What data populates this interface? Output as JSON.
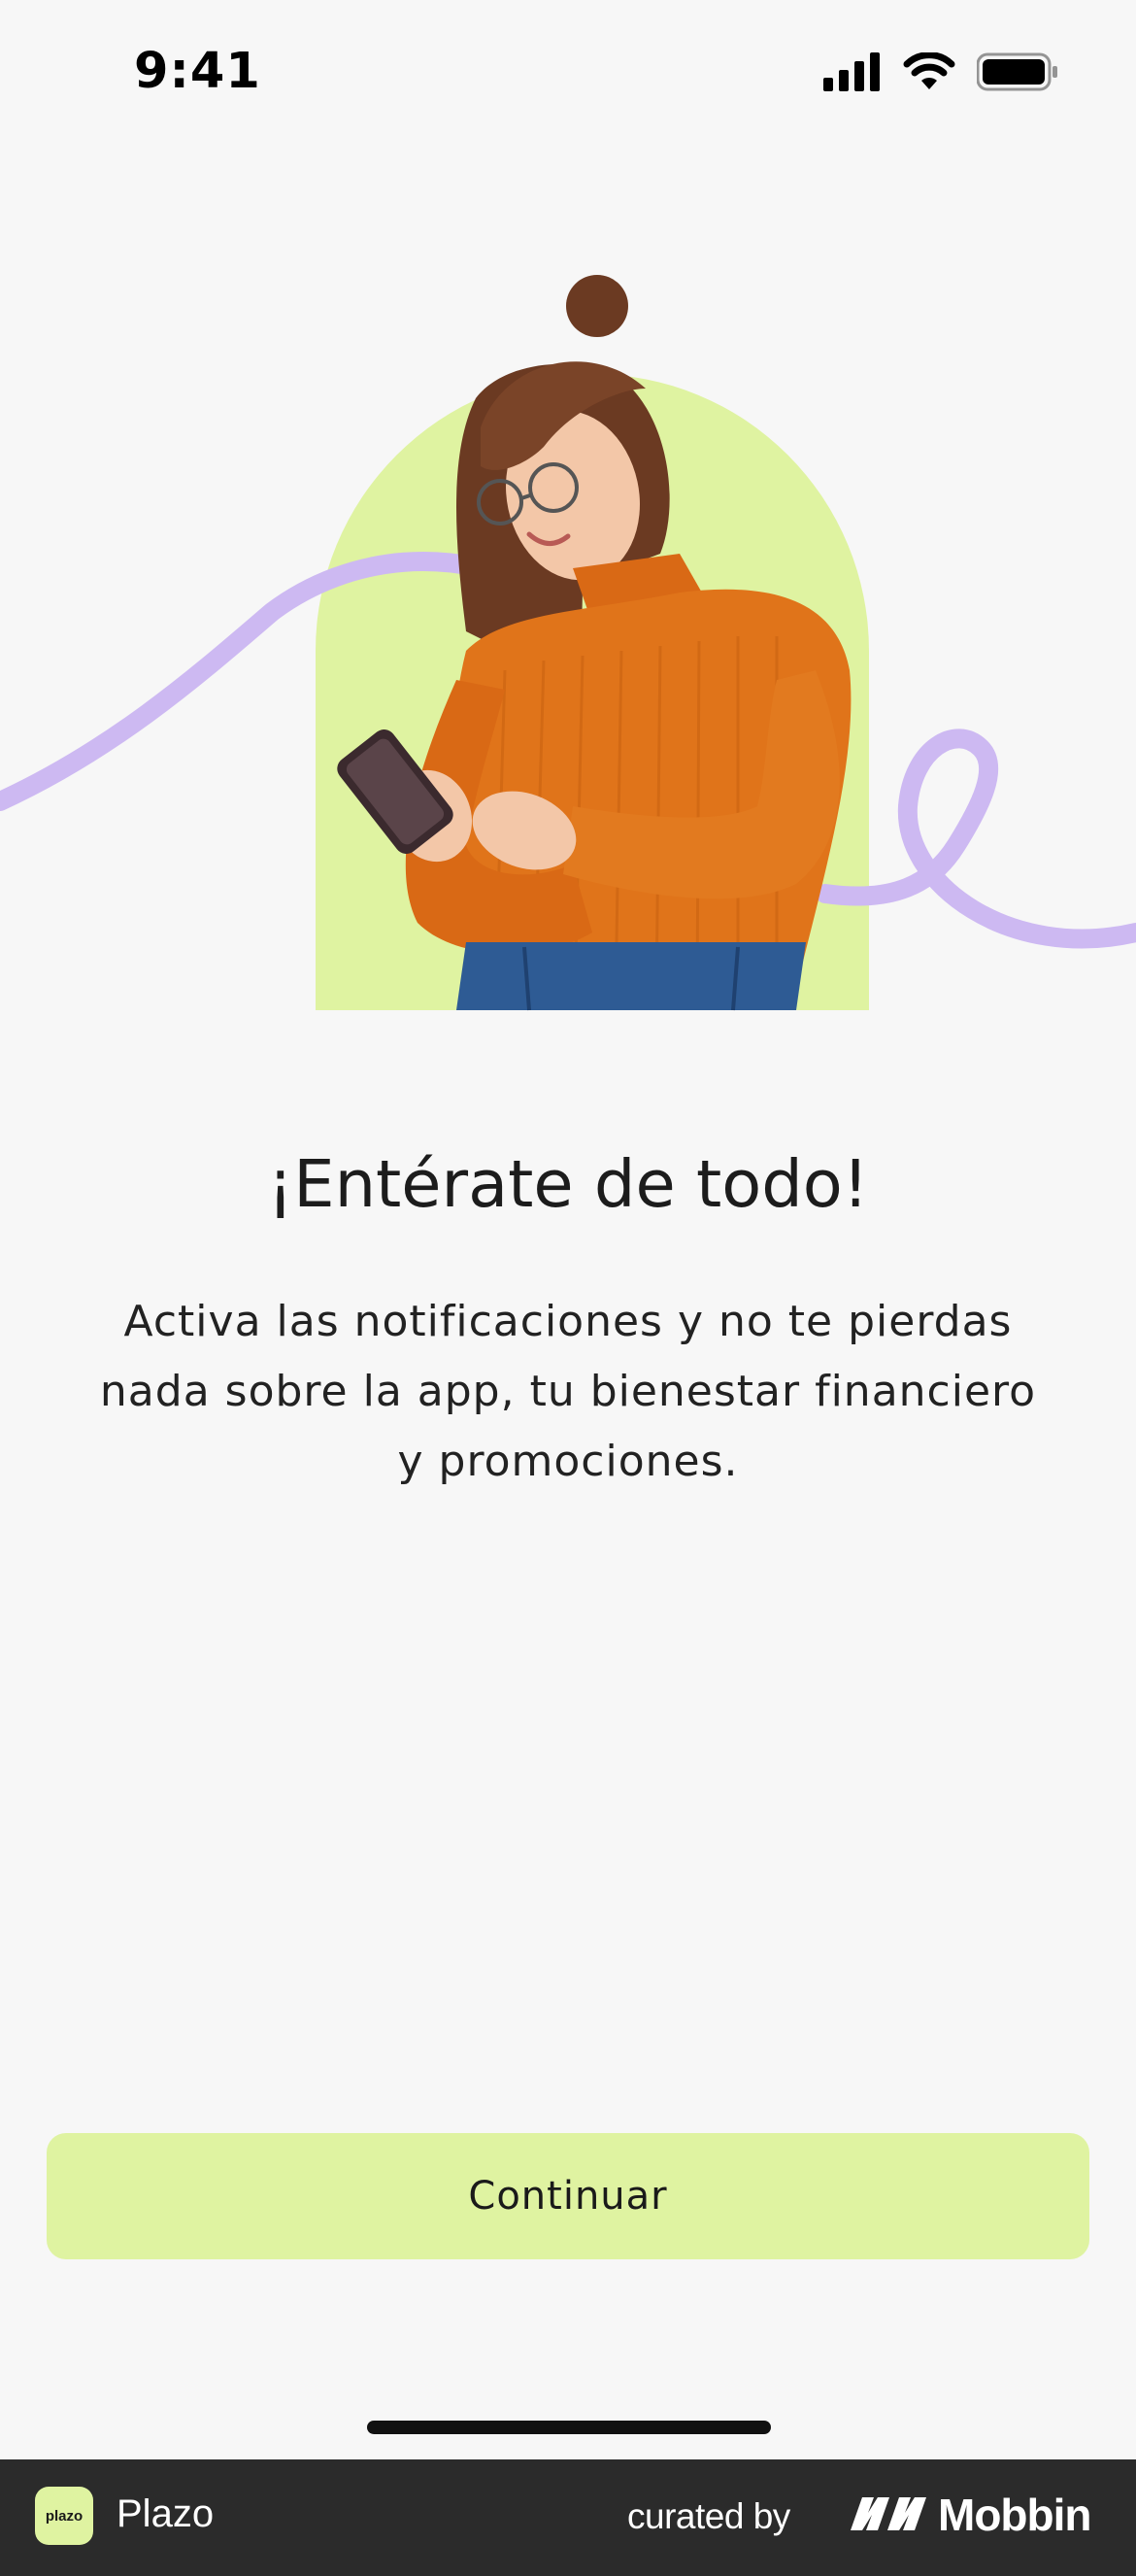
{
  "status_bar": {
    "time": "9:41"
  },
  "hero": {
    "accent_color": "#dff3a1",
    "ribbon_color": "#cdb9f2",
    "sweater_color": "#e0741a",
    "jeans_color": "#2e5b94"
  },
  "content": {
    "title": "¡Entérate de todo!",
    "description_lines": [
      "Activa las notificaciones y no te pierdas",
      "nada sobre la app, tu bienestar financiero",
      "y promociones."
    ]
  },
  "actions": {
    "continue_label": "Continuar",
    "continue_color": "#dff3a1"
  },
  "footer": {
    "app_icon_label": "plazo",
    "app_name": "Plazo",
    "curated_by": "curated by",
    "brand": "Mobbin"
  }
}
